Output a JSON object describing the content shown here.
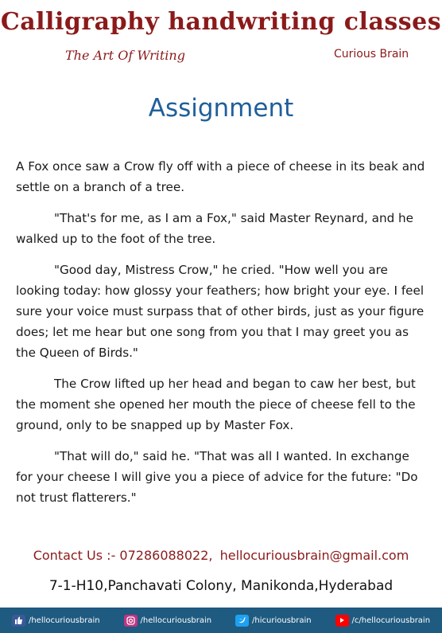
{
  "header": {
    "title": "Calligraphy handwriting classes",
    "tagline": "The Art Of Writing",
    "brand": "Curious Brain"
  },
  "heading": "Assignment",
  "paragraphs": [
    "A Fox once saw a Crow fly off with a piece of cheese in its beak and settle on a branch of a tree.",
    "\"That's for me, as I am a Fox,\" said Master Reynard, and he walked up to the foot of the tree.",
    "\"Good day, Mistress Crow,\" he cried. \"How well you are looking today: how glossy your feathers; how bright your eye. I feel sure your voice must surpass that of other birds, just as your figure does; let me hear but one song from you that I may greet you as the Queen of Birds.\"",
    "The Crow lifted up her head and began to caw her best, but the moment she opened her mouth the piece of cheese fell to the ground, only to be snapped up by Master Fox.",
    "\"That will do,\" said he. \"That was all I wanted. In exchange for your cheese I will give you a piece of advice for the future: \"Do not trust flatterers.\""
  ],
  "contact": {
    "label": "Contact Us :- 07286088022,",
    "email": "hellocuriousbrain@gmail.com"
  },
  "address": "7-1-H10,Panchavati Colony, Manikonda,Hyderabad",
  "footer": {
    "bg_color": "#1f5a80",
    "socials": [
      {
        "icon": "thumbs-up-icon",
        "handle": "/hellocuriousbrain",
        "color": "#3b5998"
      },
      {
        "icon": "instagram-icon",
        "handle": "/hellocuriousbrain",
        "color": "#c13584"
      },
      {
        "icon": "twitter-icon",
        "handle": "/hicuriousbrain",
        "color": "#1da1f2"
      },
      {
        "icon": "youtube-icon",
        "handle": "/c/hellocuriousbrain",
        "color": "#ff0000"
      }
    ]
  },
  "colors": {
    "title": "#8b1a1a",
    "heading": "#1f5f9a",
    "body_text": "#1a1a1a"
  }
}
